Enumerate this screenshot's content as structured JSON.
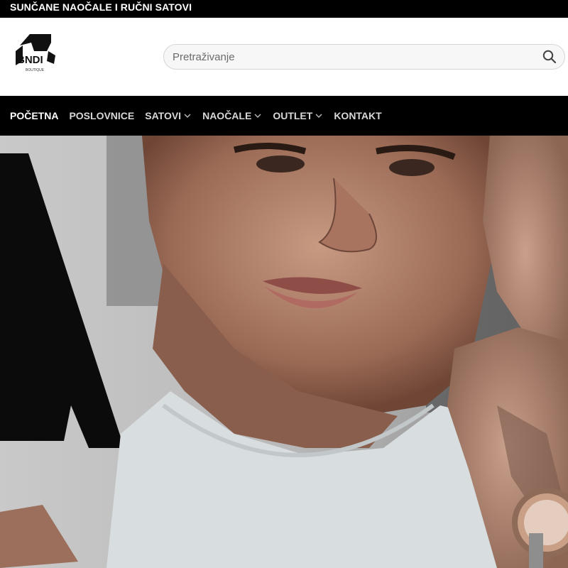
{
  "topbar": {
    "text": "SUNČANE NAOČALE I RUČNI SATOVI"
  },
  "header": {
    "logo": {
      "letters": "BNDI",
      "tagline": "BOUTIQUE"
    },
    "search": {
      "placeholder": "Pretraživanje",
      "value": "",
      "button_icon": "search-icon"
    }
  },
  "nav": {
    "items": [
      {
        "label": "POČETNA",
        "active": true,
        "dropdown": false
      },
      {
        "label": "POSLOVNICE",
        "active": false,
        "dropdown": false
      },
      {
        "label": "SATOVI",
        "active": false,
        "dropdown": true
      },
      {
        "label": "NAOČALE",
        "active": false,
        "dropdown": true
      },
      {
        "label": "OUTLET",
        "active": false,
        "dropdown": true
      },
      {
        "label": "KONTAKT",
        "active": false,
        "dropdown": false
      }
    ]
  },
  "hero": {
    "image": "fashion-campaign-photo"
  },
  "colors": {
    "bar": "#000000",
    "text_light": "#ffffff",
    "nav_text": "#d8d8d8"
  }
}
